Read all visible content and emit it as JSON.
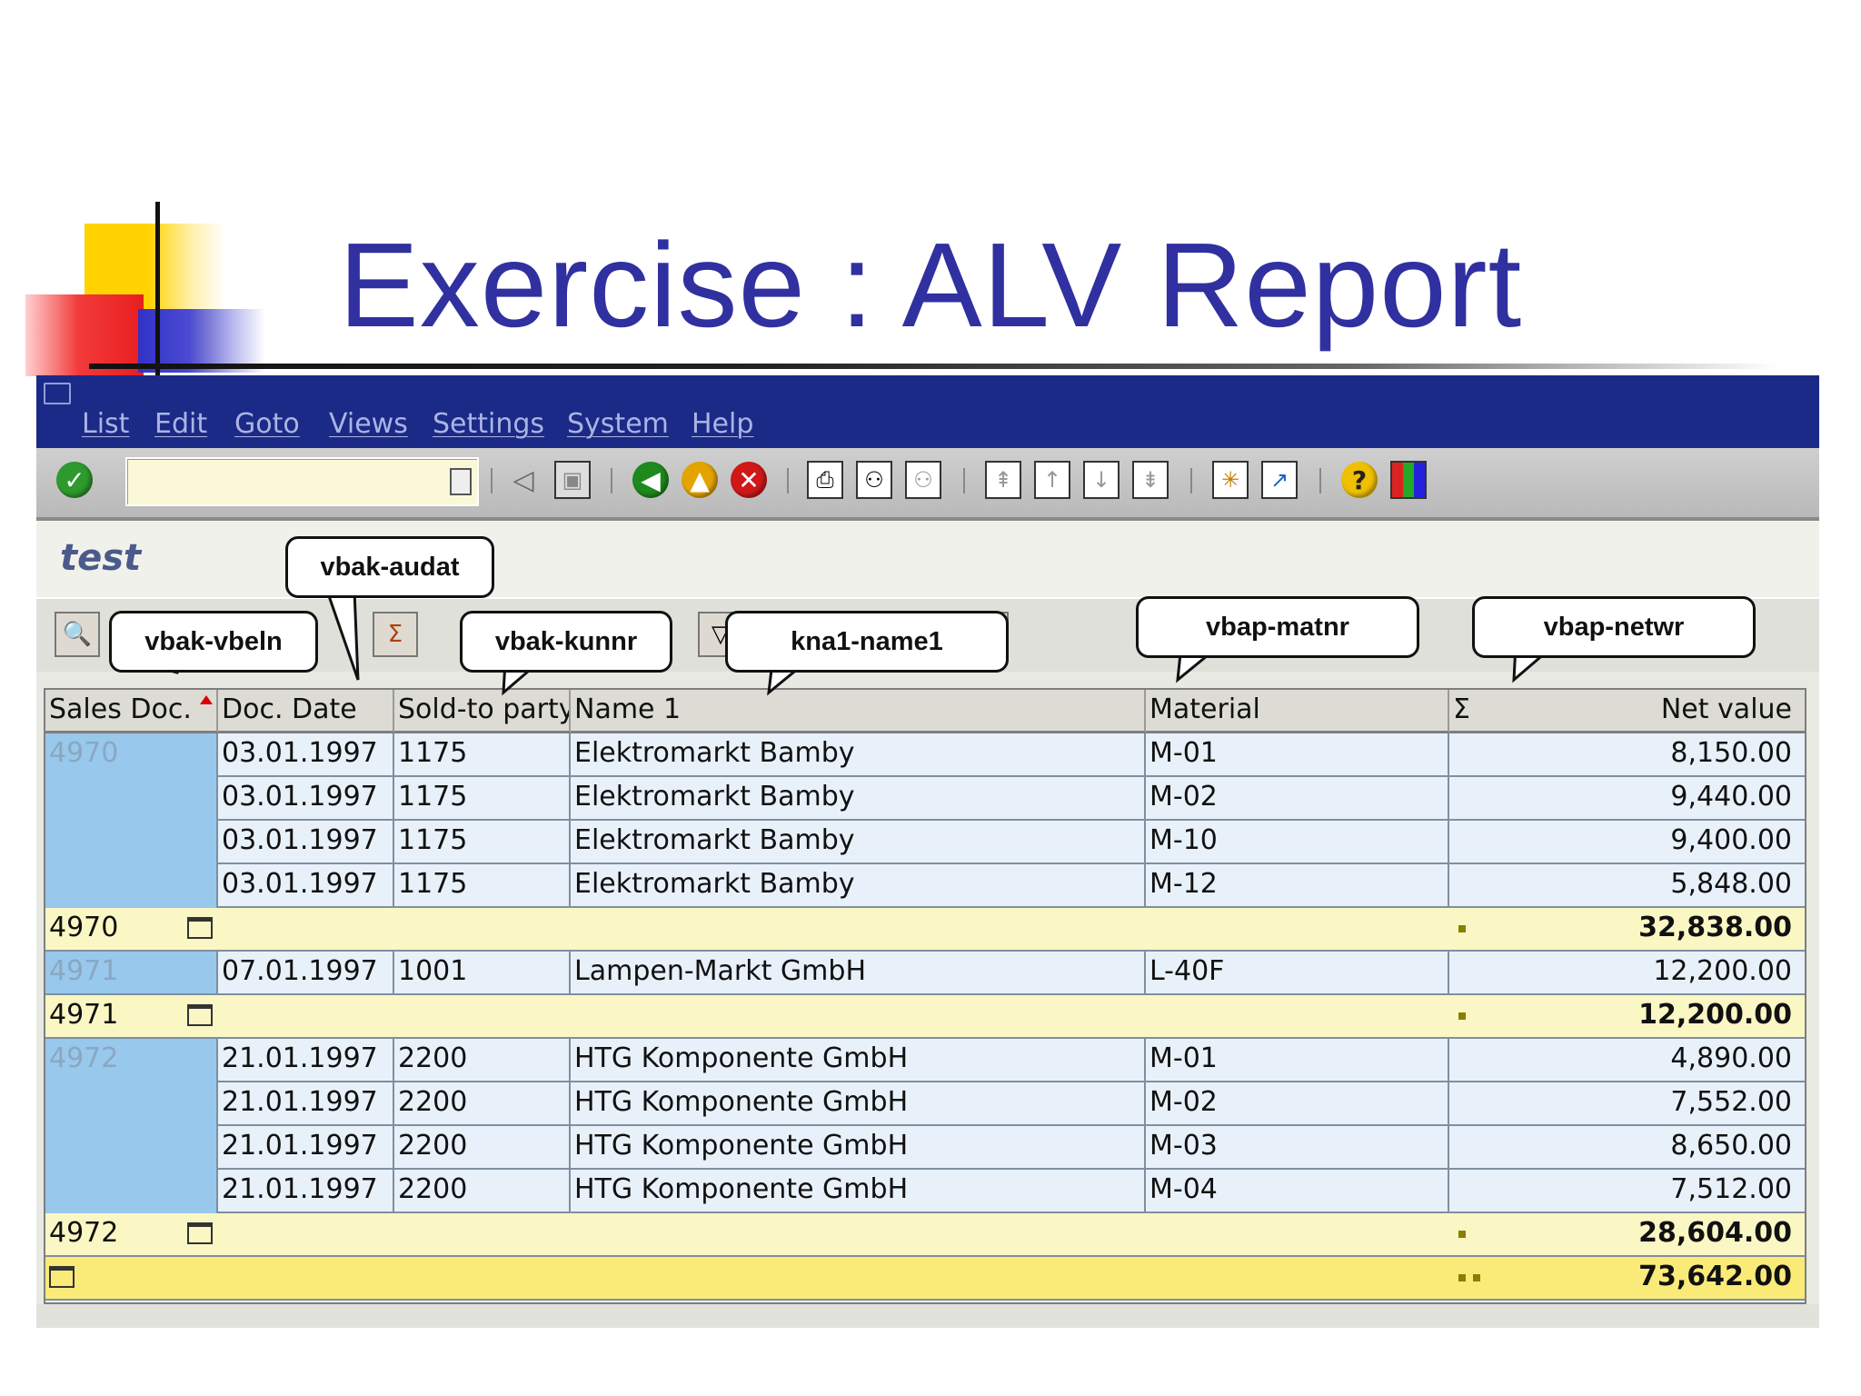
{
  "slide_title": "Exercise : ALV Report",
  "menu": [
    "List",
    "Edit",
    "Goto",
    "Views",
    "Settings",
    "System",
    "Help"
  ],
  "command_field": {
    "value": ""
  },
  "program_title": "test",
  "callouts": [
    "vbak-vbeln",
    "vbak-audat",
    "vbak-kunnr",
    "kna1-name1",
    "vbap-matnr",
    "vbap-netwr"
  ],
  "table": {
    "headers": [
      "Sales Doc.",
      "Doc. Date",
      "Sold-to party",
      "Name 1",
      "Material",
      "Σ",
      "Net value"
    ],
    "rows": [
      {
        "type": "item",
        "doc": "4970",
        "date": "03.01.1997",
        "party": "1175",
        "name": "Elektromarkt Bamby",
        "material": "M-01",
        "value": "8,150.00"
      },
      {
        "type": "item",
        "doc": "",
        "date": "03.01.1997",
        "party": "1175",
        "name": "Elektromarkt Bamby",
        "material": "M-02",
        "value": "9,440.00"
      },
      {
        "type": "item",
        "doc": "",
        "date": "03.01.1997",
        "party": "1175",
        "name": "Elektromarkt Bamby",
        "material": "M-10",
        "value": "9,400.00"
      },
      {
        "type": "item",
        "doc": "",
        "date": "03.01.1997",
        "party": "1175",
        "name": "Elektromarkt Bamby",
        "material": "M-12",
        "value": "5,848.00"
      },
      {
        "type": "subtotal",
        "doc": "4970",
        "value": "32,838.00"
      },
      {
        "type": "item",
        "doc": "4971",
        "date": "07.01.1997",
        "party": "1001",
        "name": "Lampen-Markt GmbH",
        "material": "L-40F",
        "value": "12,200.00"
      },
      {
        "type": "subtotal",
        "doc": "4971",
        "value": "12,200.00"
      },
      {
        "type": "item",
        "doc": "4972",
        "date": "21.01.1997",
        "party": "2200",
        "name": "HTG Komponente GmbH",
        "material": "M-01",
        "value": "4,890.00"
      },
      {
        "type": "item",
        "doc": "",
        "date": "21.01.1997",
        "party": "2200",
        "name": "HTG Komponente GmbH",
        "material": "M-02",
        "value": "7,552.00"
      },
      {
        "type": "item",
        "doc": "",
        "date": "21.01.1997",
        "party": "2200",
        "name": "HTG Komponente GmbH",
        "material": "M-03",
        "value": "8,650.00"
      },
      {
        "type": "item",
        "doc": "",
        "date": "21.01.1997",
        "party": "2200",
        "name": "HTG Komponente GmbH",
        "material": "M-04",
        "value": "7,512.00"
      },
      {
        "type": "subtotal",
        "doc": "4972",
        "value": "28,604.00"
      },
      {
        "type": "total",
        "doc": "",
        "value": "73,642.00"
      }
    ]
  },
  "colors": {
    "title": "#3030a0",
    "menubar": "#1b2a86",
    "key_cell": "#98c8ec",
    "subtotal": "#fbf7c4",
    "total": "#faeb78"
  }
}
